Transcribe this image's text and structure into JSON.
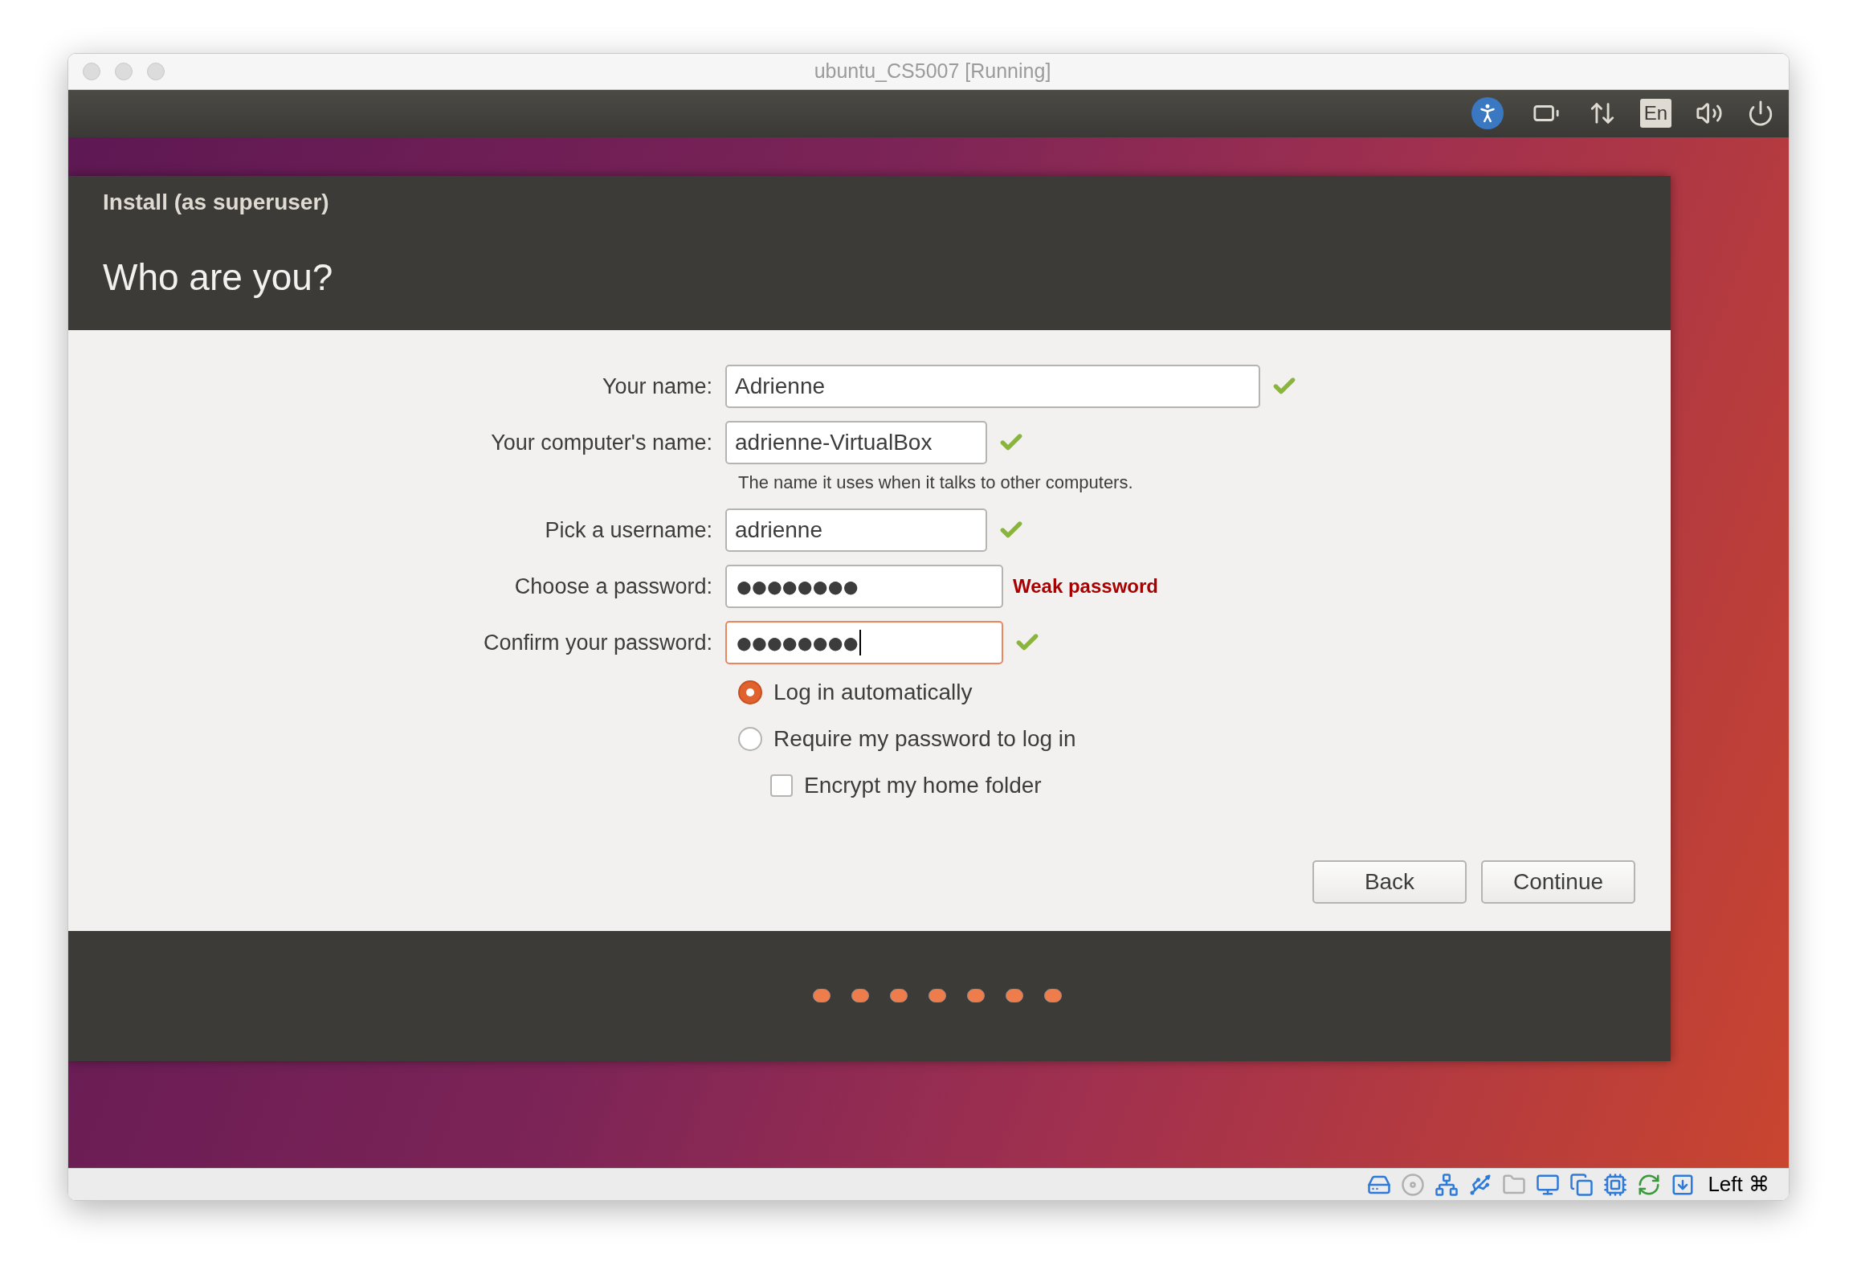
{
  "window": {
    "title": "ubuntu_CS5007 [Running]"
  },
  "top_panel": {
    "keyboard_layout": "En"
  },
  "installer": {
    "title": "Install (as superuser)",
    "heading": "Who are you?",
    "fields": [
      {
        "kind": "text",
        "label": "Your name:",
        "value": "Adrienne",
        "valid": true,
        "focused": false
      },
      {
        "kind": "text",
        "label": "Your computer's name:",
        "value": "adrienne-VirtualBox",
        "valid": true,
        "focused": false,
        "hint": "The name it uses when it talks to other computers."
      },
      {
        "kind": "text",
        "label": "Pick a username:",
        "value": "adrienne",
        "valid": true,
        "focused": false
      },
      {
        "kind": "password",
        "label": "Choose a password:",
        "value": "●●●●●●●●",
        "valid": false,
        "focused": false,
        "note": "Weak password"
      },
      {
        "kind": "password",
        "label": "Confirm your password:",
        "value": "●●●●●●●●",
        "valid": true,
        "focused": true
      }
    ],
    "login_options": [
      {
        "label": "Log in automatically",
        "selected": true
      },
      {
        "label": "Require my password to log in",
        "selected": false
      }
    ],
    "encrypt": {
      "label": "Encrypt my home folder",
      "checked": false
    },
    "buttons": [
      "Back",
      "Continue"
    ],
    "slideshow_dots": [
      {
        "kind": "dot"
      },
      {
        "kind": "dot"
      },
      {
        "kind": "dot"
      },
      {
        "kind": "dot"
      },
      {
        "kind": "dot"
      },
      {
        "kind": "dot"
      },
      {
        "kind": "dot"
      }
    ]
  },
  "status_bar": {
    "host_key": "Left ⌘"
  }
}
